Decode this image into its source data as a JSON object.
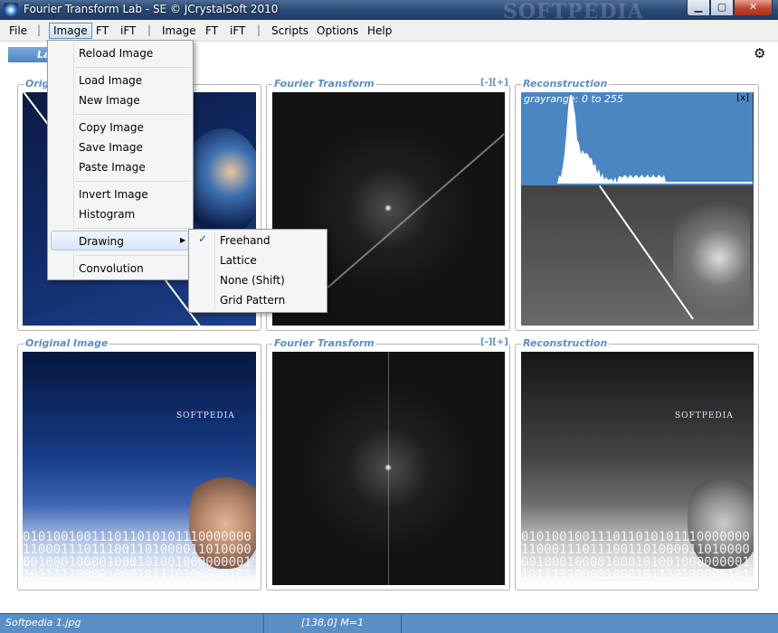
{
  "window": {
    "title": "Fourier Transform Lab - SE  © JCrystalSoft 2010",
    "watermark": "SOFTPEDIA",
    "minimize_glyph": "▁",
    "maximize_glyph": "▢",
    "close_glyph": "✕"
  },
  "menubar": {
    "items": [
      {
        "label": "File"
      },
      {
        "label": "Image"
      },
      {
        "label": "FT"
      },
      {
        "label": "iFT"
      },
      {
        "label": "Image"
      },
      {
        "label": "FT"
      },
      {
        "label": "iFT"
      },
      {
        "label": "Scripts"
      },
      {
        "label": "Options"
      },
      {
        "label": "Help"
      }
    ],
    "separator": "|"
  },
  "toolbar": {
    "tab_label": "La",
    "settings_glyph": "⚙"
  },
  "panels": {
    "top_original_label": "Origi",
    "top_ft_label": "Fourier Transform",
    "top_ft_controls": "[-][+]",
    "top_recon_label": "Reconstruction",
    "histogram_text": "grayrange: 0 to 255",
    "histogram_close": "[x]",
    "bottom_original_label": "Original Image",
    "bottom_ft_label": "Fourier Transform",
    "bottom_ft_controls": "[-][+]",
    "bottom_recon_label": "Reconstruction",
    "logo_text": "SOFTPEDIA"
  },
  "image_menu": {
    "items": [
      {
        "label": "Reload Image"
      },
      {
        "label": "Load Image"
      },
      {
        "label": "New Image"
      },
      {
        "label": "Copy Image"
      },
      {
        "label": "Save Image"
      },
      {
        "label": "Paste Image"
      },
      {
        "label": "Invert Image"
      },
      {
        "label": "Histogram"
      },
      {
        "label": "Drawing"
      },
      {
        "label": "Convolution"
      }
    ],
    "submenu_arrow": "▶"
  },
  "drawing_submenu": {
    "check_glyph": "✓",
    "items": [
      {
        "label": "Freehand",
        "checked": true
      },
      {
        "label": "Lattice"
      },
      {
        "label": "None (Shift)"
      },
      {
        "label": "Grid Pattern"
      }
    ]
  },
  "statusbar": {
    "filename": "Softpedia 1.jpg",
    "coords": "[138,0]  M=1"
  }
}
